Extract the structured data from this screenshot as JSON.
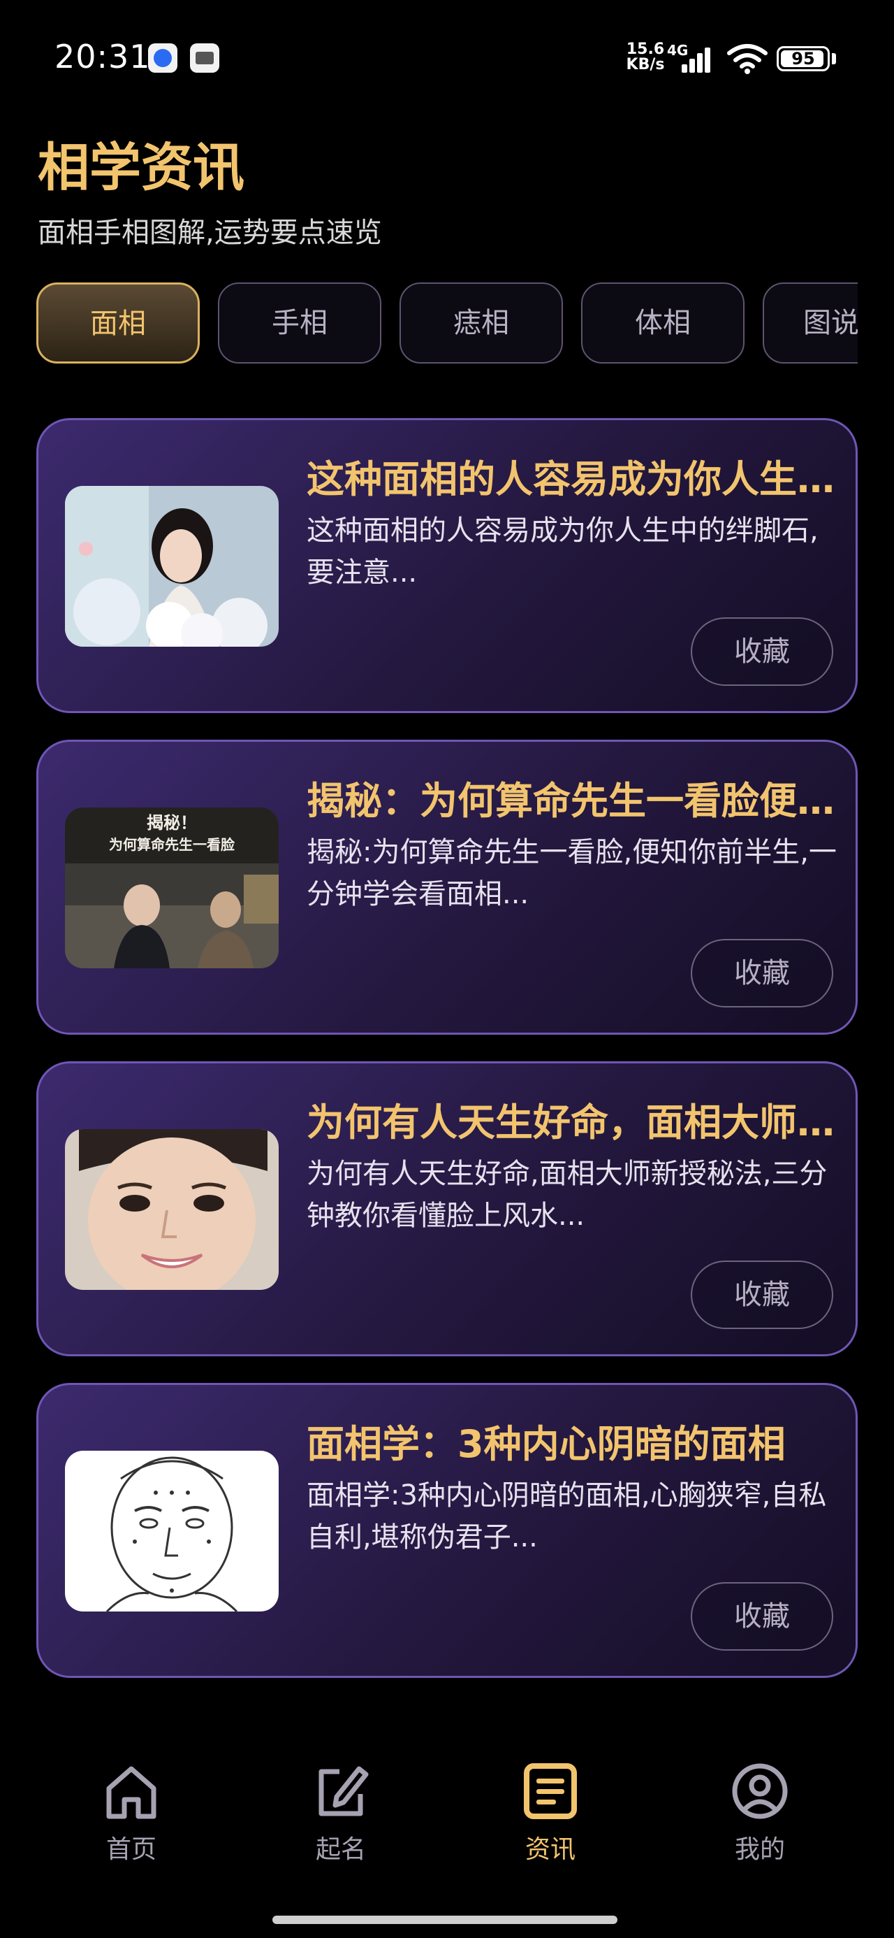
{
  "status_bar": {
    "time": "20:31",
    "net_speed_value": "15.6",
    "net_speed_unit": "KB/s",
    "net_type": "4G",
    "battery": "95",
    "notification_icons": [
      "message-bubble-icon",
      "app-notification-icon"
    ]
  },
  "header": {
    "title": "相学资讯",
    "subtitle": "面相手相图解,运势要点速览"
  },
  "tabs": [
    {
      "label": "面相",
      "active": true
    },
    {
      "label": "手相",
      "active": false
    },
    {
      "label": "痣相",
      "active": false
    },
    {
      "label": "体相",
      "active": false
    },
    {
      "label": "图说",
      "active": false
    }
  ],
  "articles": [
    {
      "title": "这种面相的人容易成为你人生中的绊脚石",
      "desc": "这种面相的人容易成为你人生中的绊脚石,要注意...",
      "fav_label": "收藏",
      "thumb": "woman-with-balloons-photo"
    },
    {
      "title": "揭秘：为何算命先生一看脸便知你前半生",
      "desc": "揭秘:为何算命先生一看脸,便知你前半生,一分钟学会看面相...",
      "fav_label": "收藏",
      "thumb": "fortune-teller-scene-photo",
      "thumb_caption_line1": "揭秘！",
      "thumb_caption_line2": "为何算命先生一看脸"
    },
    {
      "title": "为何有人天生好命，面相大师新授秘法",
      "desc": "为何有人天生好命,面相大师新授秘法,三分钟教你看懂脸上风水...",
      "fav_label": "收藏",
      "thumb": "smiling-woman-face-photo"
    },
    {
      "title": "面相学：3种内心阴暗的面相",
      "desc": "面相学:3种内心阴暗的面相,心胸狭窄,自私自利,堪称伪君子...",
      "fav_label": "收藏",
      "thumb": "face-reading-chart-drawing"
    }
  ],
  "bottom_nav": [
    {
      "label": "首页",
      "icon": "home-icon",
      "active": false
    },
    {
      "label": "起名",
      "icon": "edit-icon",
      "active": false
    },
    {
      "label": "资讯",
      "icon": "news-document-icon",
      "active": true
    },
    {
      "label": "我的",
      "icon": "user-profile-icon",
      "active": false
    }
  ],
  "colors": {
    "accent_gold": "#f2c46d",
    "card_border": "#6f56b5",
    "card_bg": "#2c1f52",
    "background": "#000000"
  }
}
